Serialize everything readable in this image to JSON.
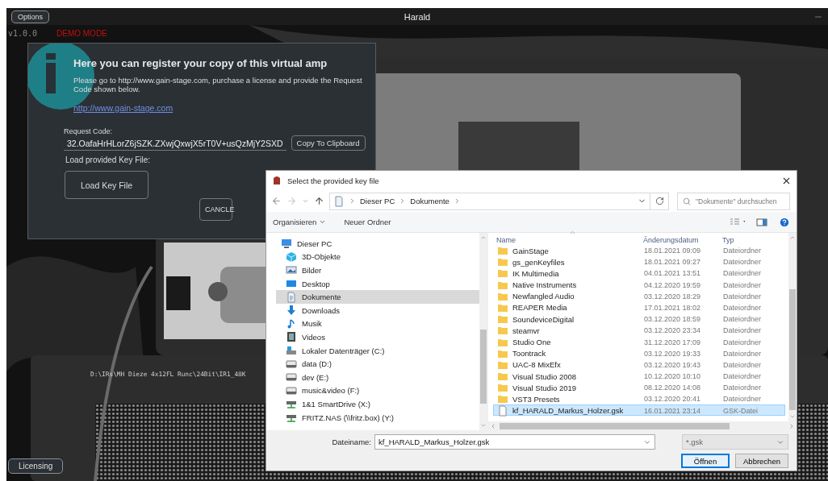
{
  "app": {
    "options_button": "Options",
    "title": "Harald",
    "version": "v1.0.0",
    "mode": "DEMO MODE",
    "ir_path": "D:\\IRs\\MH Dieze 4x12FL Runc\\24Bit\\IR1_48K",
    "licensing_button": "Licensing"
  },
  "register_dialog": {
    "title": "Here you can register your copy of this virtual amp",
    "text": "Please go to http://www.gain-stage.com, purchase a license and provide the Request Code shown below.",
    "link": "http://www.gain-stage.com",
    "request_code_label": "Request Code:",
    "request_code": "32.OafaHrHLorZ6jSZK.ZXwjQxwjX5rT0V+usQzMjY2SXD",
    "copy_button": "Copy To Clipboard",
    "key_file_label": "Load provided Key File:",
    "load_button": "Load Key File",
    "cancel_button": "CANCLE"
  },
  "file_dialog": {
    "title": "Select the provided key file",
    "breadcrumb": [
      "Dieser PC",
      "Dokumente"
    ],
    "search": {
      "placeholder": "\"Dokumente\" durchsuchen"
    },
    "organize_button": "Organisieren",
    "new_folder_button": "Neuer Ordner",
    "tree": [
      {
        "label": "Dieser PC",
        "kind": "pc",
        "selected": false
      },
      {
        "label": "3D-Objekte",
        "kind": "objects",
        "selected": false
      },
      {
        "label": "Bilder",
        "kind": "pictures",
        "selected": false
      },
      {
        "label": "Desktop",
        "kind": "desktop",
        "selected": false
      },
      {
        "label": "Dokumente",
        "kind": "documents",
        "selected": true
      },
      {
        "label": "Downloads",
        "kind": "downloads",
        "selected": false
      },
      {
        "label": "Musik",
        "kind": "music",
        "selected": false
      },
      {
        "label": "Videos",
        "kind": "videos",
        "selected": false
      },
      {
        "label": "Lokaler Datenträger (C:)",
        "kind": "system-drive",
        "selected": false
      },
      {
        "label": "data (D:)",
        "kind": "drive",
        "selected": false
      },
      {
        "label": "dev (E:)",
        "kind": "drive",
        "selected": false
      },
      {
        "label": "music&video (F:)",
        "kind": "drive",
        "selected": false
      },
      {
        "label": "1&1 SmartDrive (X:)",
        "kind": "network-drive",
        "selected": false
      },
      {
        "label": "FRITZ.NAS (\\\\fritz.box) (Y:)",
        "kind": "network-drive",
        "selected": false
      }
    ],
    "columns": [
      "Name",
      "Änderungsdatum",
      "Typ"
    ],
    "files": [
      {
        "name": "GainStage",
        "date": "18.01.2021 09:09",
        "type": "Dateiordner",
        "kind": "folder",
        "selected": false
      },
      {
        "name": "gs_genKeyfiles",
        "date": "18.01.2021 09:27",
        "type": "Dateiordner",
        "kind": "folder",
        "selected": false
      },
      {
        "name": "IK Multimedia",
        "date": "04.01.2021 13:51",
        "type": "Dateiordner",
        "kind": "folder",
        "selected": false
      },
      {
        "name": "Native Instruments",
        "date": "04.12.2020 19:59",
        "type": "Dateiordner",
        "kind": "folder",
        "selected": false
      },
      {
        "name": "Newfangled Audio",
        "date": "03.12.2020 18:29",
        "type": "Dateiordner",
        "kind": "folder",
        "selected": false
      },
      {
        "name": "REAPER Media",
        "date": "17.01.2021 18:02",
        "type": "Dateiordner",
        "kind": "folder",
        "selected": false
      },
      {
        "name": "SoundeviceDigital",
        "date": "03.12.2020 18:59",
        "type": "Dateiordner",
        "kind": "folder",
        "selected": false
      },
      {
        "name": "steamvr",
        "date": "03.12.2020 23:34",
        "type": "Dateiordner",
        "kind": "folder",
        "selected": false
      },
      {
        "name": "Studio One",
        "date": "31.12.2020 17:09",
        "type": "Dateiordner",
        "kind": "folder",
        "selected": false
      },
      {
        "name": "Toontrack",
        "date": "03.12.2020 19:33",
        "type": "Dateiordner",
        "kind": "folder",
        "selected": false
      },
      {
        "name": "UAC-8 MixEfx",
        "date": "03.12.2020 19:43",
        "type": "Dateiordner",
        "kind": "folder",
        "selected": false
      },
      {
        "name": "Visual Studio 2008",
        "date": "10.12.2020 10:10",
        "type": "Dateiordner",
        "kind": "folder",
        "selected": false
      },
      {
        "name": "Visual Studio 2019",
        "date": "08.12.2020 14:08",
        "type": "Dateiordner",
        "kind": "folder",
        "selected": false
      },
      {
        "name": "VST3 Presets",
        "date": "03.12.2020 20:41",
        "type": "Dateiordner",
        "kind": "folder",
        "selected": false
      },
      {
        "name": "kf_HARALD_Markus_Holzer.gsk",
        "date": "16.01.2021 23:14",
        "type": "GSK-Datei",
        "kind": "file",
        "selected": true
      }
    ],
    "filename_label": "Dateiname:",
    "filename": "kf_HARALD_Markus_Holzer.gsk",
    "filter": "*.gsk",
    "buttons": [
      {
        "label": "Öffnen",
        "default": true
      },
      {
        "label": "Abbrechen",
        "default": false
      }
    ]
  }
}
